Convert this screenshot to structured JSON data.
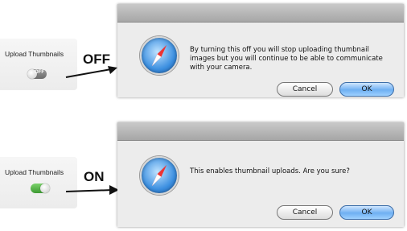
{
  "top": {
    "label": "Upload Thumbnails",
    "toggle_state_text": "OFF",
    "callout": "OFF",
    "dialog_message": "By turning this off you will stop uploading thumbnail images but you will continue to be able to communicate with your camera.",
    "cancel_label": "Cancel",
    "ok_label": "OK"
  },
  "bottom": {
    "label": "Upload Thumbnails",
    "callout": "ON",
    "dialog_message": "This enables thumbnail uploads.  Are you sure?",
    "cancel_label": "Cancel",
    "ok_label": "OK"
  },
  "icons": {
    "dialog_icon": "safari-compass-icon",
    "arrow": "arrow-right-icon"
  },
  "colors": {
    "toggle_off": "#7a7a7a",
    "toggle_on": "#4caf3e",
    "default_button": "#6fb0f2"
  }
}
